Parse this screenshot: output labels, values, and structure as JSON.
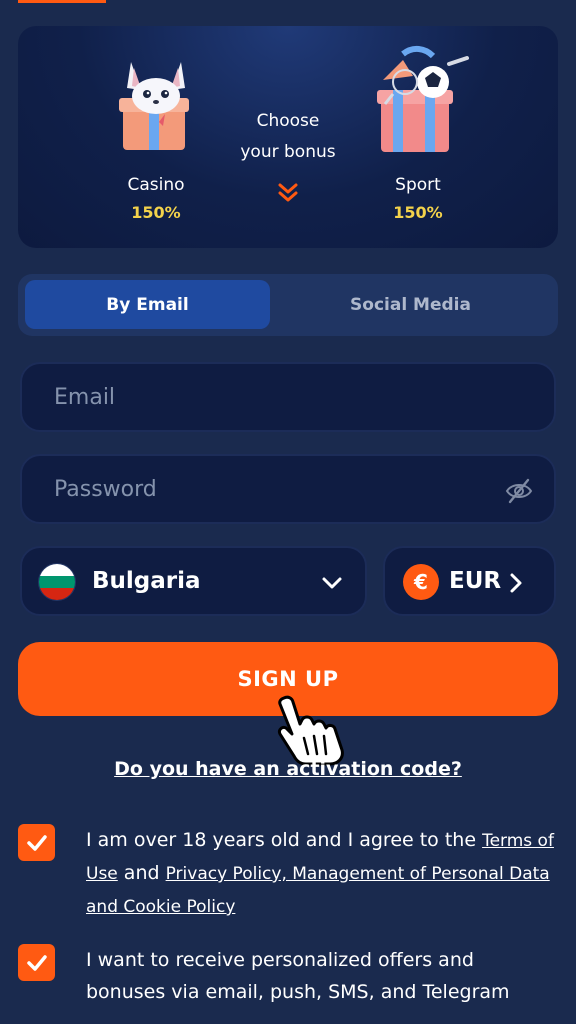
{
  "bonus": {
    "casino": {
      "name": "Casino",
      "percent": "150%"
    },
    "sport": {
      "name": "Sport",
      "percent": "150%"
    },
    "choose_line1": "Choose",
    "choose_line2": "your bonus"
  },
  "tabs": [
    {
      "label": "By Email",
      "active": true
    },
    {
      "label": "Social Media",
      "active": false
    }
  ],
  "form": {
    "email_placeholder": "Email",
    "email_value": "",
    "password_placeholder": "Password",
    "password_value": "",
    "country": "Bulgaria",
    "currency": "EUR",
    "currency_symbol": "€",
    "signup_label": "SIGN UP",
    "activation_link": "Do you have an activation code?"
  },
  "consents": {
    "terms": {
      "checked": true,
      "text_before": "I am over 18 years old and I agree to the ",
      "link1": "Terms of Use",
      "text_mid": " and ",
      "link2": "Privacy Policy, Management of Personal Data and Cookie Policy"
    },
    "offers": {
      "checked": true,
      "text": "I want to receive personalized offers and bonuses via email, push, SMS, and Telegram"
    }
  },
  "colors": {
    "accent": "#ff5a12",
    "background": "#1a2a4e",
    "bonus_yellow": "#f3d24b",
    "active_tab": "#1f4aa0"
  },
  "icons": [
    "fox-gift-icon",
    "sport-gift-icon",
    "double-chevron-down-icon",
    "eye-off-icon",
    "bulgaria-flag-icon",
    "chevron-down-icon",
    "euro-icon",
    "chevron-right-icon",
    "hand-pointer-icon",
    "checkmark-icon"
  ]
}
